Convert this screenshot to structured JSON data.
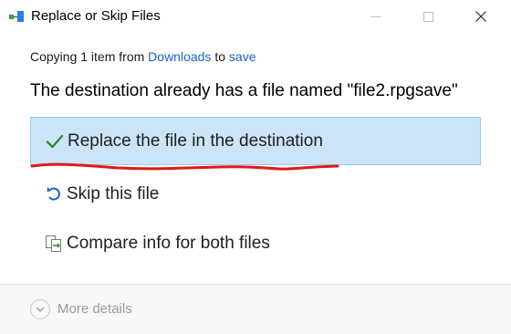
{
  "window": {
    "title": "Replace or Skip Files",
    "app_icon": "file-move-icon"
  },
  "status": {
    "prefix": "Copying 1 item from ",
    "source": "Downloads",
    "middle": " to ",
    "destination": "save"
  },
  "heading": "The destination already has a file named \"file2.rpgsave\"",
  "options": [
    {
      "label": "Replace the file in the destination",
      "icon": "checkmark-icon",
      "selected": true
    },
    {
      "label": "Skip this file",
      "icon": "skip-arrow-icon",
      "selected": false
    },
    {
      "label": "Compare info for both files",
      "icon": "compare-files-icon",
      "selected": false
    }
  ],
  "footer": {
    "more_details": "More details",
    "icon": "chevron-down-icon"
  },
  "colors": {
    "accent_link": "#1a64c8",
    "selection_bg": "#cce4f7",
    "selection_border": "#99c9ef",
    "annotation": "#e01818",
    "check": "#2e8b2e"
  }
}
